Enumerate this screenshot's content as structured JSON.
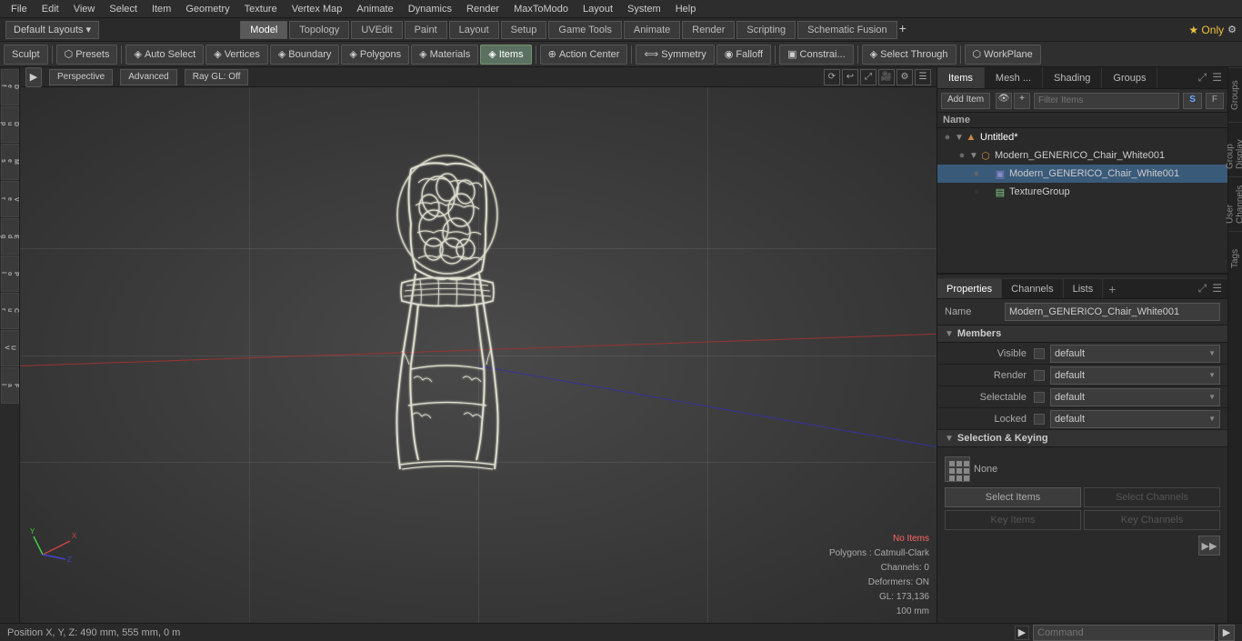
{
  "menu": {
    "items": [
      "File",
      "Edit",
      "View",
      "Select",
      "Item",
      "Geometry",
      "Texture",
      "Vertex Map",
      "Animate",
      "Dynamics",
      "Render",
      "MaxToModo",
      "Layout",
      "System",
      "Help"
    ]
  },
  "layout_bar": {
    "dropdown": "Default Layouts ▾",
    "tabs": [
      "Model",
      "Topology",
      "UVEdit",
      "Paint",
      "Layout",
      "Setup",
      "Game Tools",
      "Animate",
      "Render",
      "Scripting",
      "Schematic Fusion"
    ],
    "active_tab": "Model",
    "only_label": "★ Only",
    "settings_icon": "⚙"
  },
  "toolbar": {
    "sculpt_label": "Sculpt",
    "presets_label": "⬡ Presets",
    "auto_select_label": "◈ Auto Select",
    "vertices_label": "◈ Vertices",
    "boundary_label": "◈ Boundary",
    "polygons_label": "◈ Polygons",
    "materials_label": "◈ Materials",
    "items_label": "◈ Items",
    "action_center_label": "⊕ Action Center",
    "symmetry_label": "⟺ Symmetry",
    "falloff_label": "◉ Falloff",
    "constraints_label": "▣ Constrai...",
    "select_through_label": "◈ Select Through",
    "workplane_label": "⬡ WorkPlane"
  },
  "viewport": {
    "mode": "Perspective",
    "advanced": "Advanced",
    "ray_gl": "Ray GL: Off",
    "no_items": "No Items",
    "polygons": "Polygons : Catmull-Clark",
    "channels": "Channels: 0",
    "deformers": "Deformers: ON",
    "gl_coords": "GL: 173,136",
    "size_mm": "100 mm",
    "position": "Position X, Y, Z:  490 mm, 555 mm, 0 m"
  },
  "right_panel": {
    "tabs": [
      "Items",
      "Mesh ...",
      "Shading",
      "Groups"
    ],
    "active_tab": "Items",
    "add_item_label": "Add Item",
    "filter_placeholder": "Filter Items",
    "tree_column": "Name",
    "tree_items": [
      {
        "id": "untitled",
        "label": "Untitled*",
        "level": 0,
        "type": "scene",
        "expanded": true,
        "eye": true
      },
      {
        "id": "chair_group",
        "label": "Modern_GENERICO_Chair_White001",
        "level": 1,
        "type": "group",
        "expanded": true,
        "eye": true
      },
      {
        "id": "chair_mesh",
        "label": "Modern_GENERICO_Chair_White001",
        "level": 2,
        "type": "mesh",
        "expanded": false,
        "eye": true
      },
      {
        "id": "texture_group",
        "label": "TextureGroup",
        "level": 2,
        "type": "texture",
        "expanded": false,
        "eye": false
      }
    ]
  },
  "properties": {
    "tabs": [
      "Properties",
      "Channels",
      "Lists"
    ],
    "active_tab": "Properties",
    "name_label": "Name",
    "name_value": "Modern_GENERICO_Chair_White001",
    "members_section": "Members",
    "visible_label": "Visible",
    "visible_value": "default",
    "render_label": "Render",
    "render_value": "default",
    "selectable_label": "Selectable",
    "selectable_value": "default",
    "locked_label": "Locked",
    "locked_value": "default",
    "sel_keying_section": "Selection & Keying",
    "keying_icon": "⠿",
    "keying_none": "None",
    "select_items_btn": "Select Items",
    "select_channels_btn": "Select Channels",
    "key_items_btn": "Key Items",
    "key_channels_btn": "Key Channels"
  },
  "far_right_tabs": [
    "Groups",
    "Group Display",
    "User Channels",
    "Tags"
  ],
  "bottom": {
    "position": "Position X, Y, Z:  490 mm, 555 mm, 0 m",
    "command_placeholder": "Command",
    "arrow_label": "►"
  }
}
